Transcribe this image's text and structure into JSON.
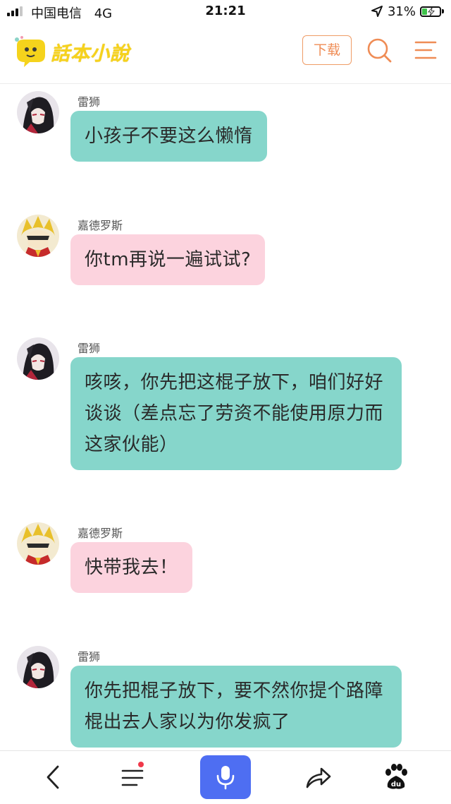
{
  "status_bar": {
    "carrier": "中国电信",
    "network": "4G",
    "time": "21:21",
    "battery_percent": "31%",
    "battery_level": 0.31,
    "battery_color": "#3ec24a"
  },
  "header": {
    "logo_text": "話本小說",
    "download_label": "下载",
    "search_icon": "search-icon",
    "menu_icon": "menu-icon",
    "accent_color": "#ef8c55"
  },
  "messages": [
    {
      "speaker": "雷狮",
      "text": "小孩子不要这么懒惰",
      "color": "teal"
    },
    {
      "speaker": "嘉德罗斯",
      "text": "你tm再说一遍试试?",
      "color": "pink"
    },
    {
      "speaker": "雷狮",
      "text": "咳咳，你先把这棍子放下，咱们好好谈谈（差点忘了劳资不能使用原力而这家伙能）",
      "color": "teal"
    },
    {
      "speaker": "嘉德罗斯",
      "text": "快带我去！",
      "color": "pink"
    },
    {
      "speaker": "雷狮",
      "text": "你先把棍子放下，要不然你提个路障棍出去人家以为你发疯了",
      "color": "teal"
    }
  ],
  "bottom_bar": {
    "back_icon": "back-arrow-icon",
    "list_icon": "list-icon",
    "voice_icon": "microphone-icon",
    "share_icon": "share-icon",
    "baidu_icon": "baidu-paw-icon",
    "voice_color": "#4e6ef2",
    "notification_dot_color": "#f0394a"
  }
}
